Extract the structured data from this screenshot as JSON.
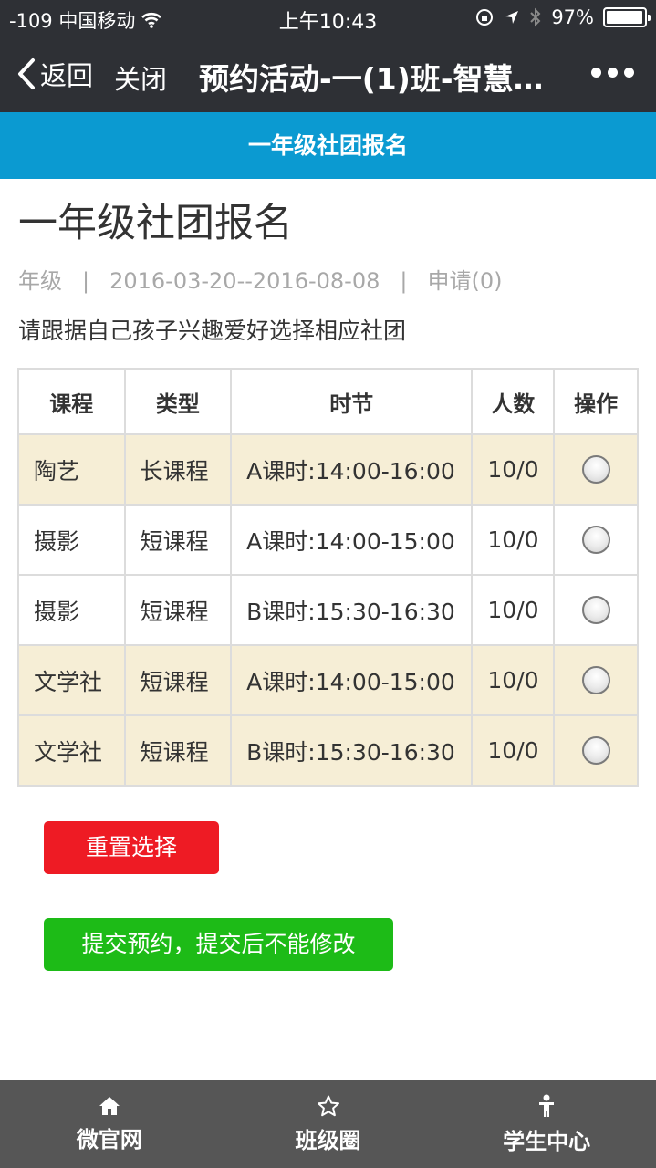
{
  "status_bar": {
    "carrier": "-109 中国移动",
    "time": "上午10:43",
    "battery": "97%",
    "battery_level": 0.97
  },
  "nav": {
    "back_label": "返回",
    "close_label": "关闭",
    "title": "预约活动-一(1)班-智慧…"
  },
  "banner": {
    "title": "一年级社团报名"
  },
  "page": {
    "title": "一年级社团报名",
    "grade": "年级",
    "sep": "|",
    "date_range": "2016-03-20--2016-08-08",
    "applications": "申请(0)",
    "description": "请跟据自己孩子兴趣爱好选择相应社团"
  },
  "table": {
    "headers": [
      "课程",
      "类型",
      "时节",
      "人数",
      "操作"
    ],
    "rows": [
      {
        "course": "陶艺",
        "type": "长课程",
        "session": "A课时:14:00-16:00",
        "count": "10/0",
        "highlight": true
      },
      {
        "course": "摄影",
        "type": "短课程",
        "session": "A课时:14:00-15:00",
        "count": "10/0",
        "highlight": false
      },
      {
        "course": "摄影",
        "type": "短课程",
        "session": "B课时:15:30-16:30",
        "count": "10/0",
        "highlight": false
      },
      {
        "course": "文学社",
        "type": "短课程",
        "session": "A课时:14:00-15:00",
        "count": "10/0",
        "highlight": true
      },
      {
        "course": "文学社",
        "type": "短课程",
        "session": "B课时:15:30-16:30",
        "count": "10/0",
        "highlight": true
      }
    ]
  },
  "buttons": {
    "reset": "重置选择",
    "submit": "提交预约，提交后不能修改"
  },
  "tabbar": [
    {
      "label": "微官网",
      "icon": "home-icon"
    },
    {
      "label": "班级圈",
      "icon": "star-icon"
    },
    {
      "label": "学生中心",
      "icon": "person-icon"
    }
  ],
  "colors": {
    "topbar": "#2e3035",
    "banner": "#0b9ad1",
    "row_highlight": "#f6eed6",
    "reset_button": "#ee1b24",
    "submit_button": "#1dbb17",
    "tabbar": "#565656"
  }
}
